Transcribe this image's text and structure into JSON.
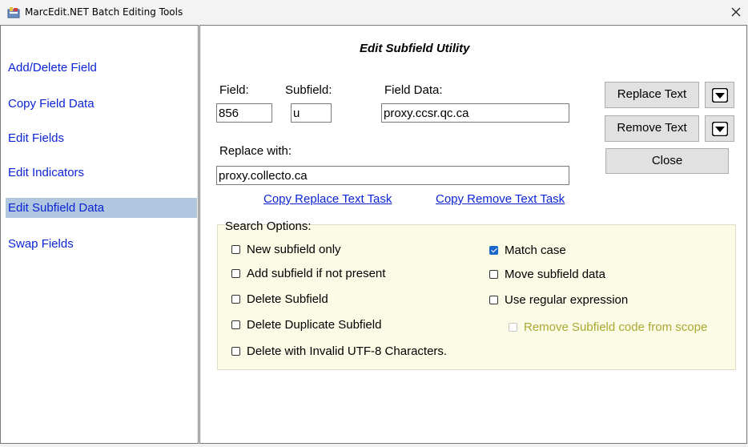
{
  "window": {
    "title": "MarcEdit.NET Batch Editing Tools"
  },
  "sidebar": {
    "items": [
      {
        "label": "Add/Delete Field",
        "active": false
      },
      {
        "label": "Copy Field Data",
        "active": false
      },
      {
        "label": "Edit Fields",
        "active": false
      },
      {
        "label": "Edit Indicators",
        "active": false
      },
      {
        "label": "Edit Subfield Data",
        "active": true
      },
      {
        "label": "Swap Fields",
        "active": false
      }
    ]
  },
  "main": {
    "heading": "Edit Subfield Utility",
    "field_label": "Field:",
    "field_value": "856",
    "subfield_label": "Subfield:",
    "subfield_value": "u",
    "field_data_label": "Field Data:",
    "field_data_value": "proxy.ccsr.qc.ca",
    "replace_with_label": "Replace with:",
    "replace_with_value": "proxy.collecto.ca",
    "copy_replace_link": "Copy Replace Text Task",
    "copy_remove_link": "Copy Remove Text Task",
    "buttons": {
      "replace_text": "Replace Text",
      "remove_text": "Remove Text",
      "close": "Close"
    },
    "search_options": {
      "title": "Search Options:",
      "left": [
        {
          "label": "New subfield only",
          "checked": false
        },
        {
          "label": "Add subfield if not present",
          "checked": false
        },
        {
          "label": "Delete Subfield",
          "checked": false
        },
        {
          "label": "Delete Duplicate Subfield",
          "checked": false
        },
        {
          "label": "Delete with Invalid UTF-8 Characters.",
          "checked": false
        }
      ],
      "right": [
        {
          "label": "Match case",
          "checked": true
        },
        {
          "label": "Move subfield data",
          "checked": false
        },
        {
          "label": "Use regular expression",
          "checked": false
        },
        {
          "label": "Remove Subfield code from scope",
          "checked": false,
          "disabled": true
        }
      ]
    }
  }
}
